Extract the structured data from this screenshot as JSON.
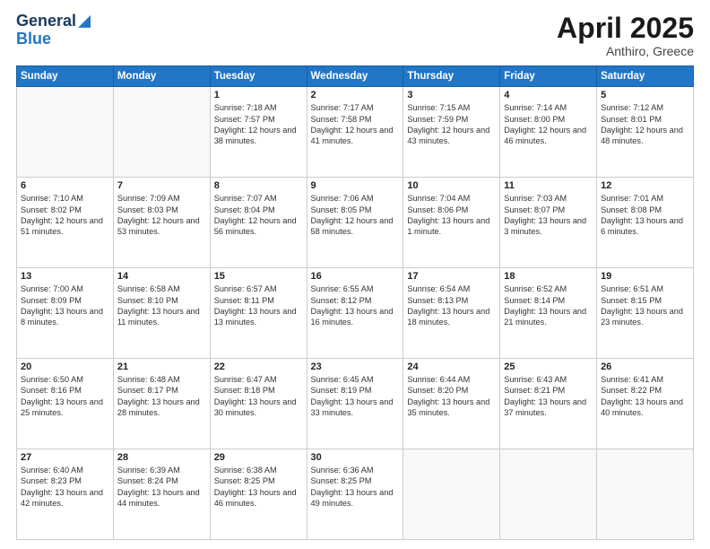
{
  "header": {
    "logo_general": "General",
    "logo_blue": "Blue",
    "title": "April 2025",
    "location": "Anthiro, Greece"
  },
  "days_of_week": [
    "Sunday",
    "Monday",
    "Tuesday",
    "Wednesday",
    "Thursday",
    "Friday",
    "Saturday"
  ],
  "weeks": [
    [
      {
        "day": "",
        "info": ""
      },
      {
        "day": "",
        "info": ""
      },
      {
        "day": "1",
        "info": "Sunrise: 7:18 AM\nSunset: 7:57 PM\nDaylight: 12 hours and 38 minutes."
      },
      {
        "day": "2",
        "info": "Sunrise: 7:17 AM\nSunset: 7:58 PM\nDaylight: 12 hours and 41 minutes."
      },
      {
        "day": "3",
        "info": "Sunrise: 7:15 AM\nSunset: 7:59 PM\nDaylight: 12 hours and 43 minutes."
      },
      {
        "day": "4",
        "info": "Sunrise: 7:14 AM\nSunset: 8:00 PM\nDaylight: 12 hours and 46 minutes."
      },
      {
        "day": "5",
        "info": "Sunrise: 7:12 AM\nSunset: 8:01 PM\nDaylight: 12 hours and 48 minutes."
      }
    ],
    [
      {
        "day": "6",
        "info": "Sunrise: 7:10 AM\nSunset: 8:02 PM\nDaylight: 12 hours and 51 minutes."
      },
      {
        "day": "7",
        "info": "Sunrise: 7:09 AM\nSunset: 8:03 PM\nDaylight: 12 hours and 53 minutes."
      },
      {
        "day": "8",
        "info": "Sunrise: 7:07 AM\nSunset: 8:04 PM\nDaylight: 12 hours and 56 minutes."
      },
      {
        "day": "9",
        "info": "Sunrise: 7:06 AM\nSunset: 8:05 PM\nDaylight: 12 hours and 58 minutes."
      },
      {
        "day": "10",
        "info": "Sunrise: 7:04 AM\nSunset: 8:06 PM\nDaylight: 13 hours and 1 minute."
      },
      {
        "day": "11",
        "info": "Sunrise: 7:03 AM\nSunset: 8:07 PM\nDaylight: 13 hours and 3 minutes."
      },
      {
        "day": "12",
        "info": "Sunrise: 7:01 AM\nSunset: 8:08 PM\nDaylight: 13 hours and 6 minutes."
      }
    ],
    [
      {
        "day": "13",
        "info": "Sunrise: 7:00 AM\nSunset: 8:09 PM\nDaylight: 13 hours and 8 minutes."
      },
      {
        "day": "14",
        "info": "Sunrise: 6:58 AM\nSunset: 8:10 PM\nDaylight: 13 hours and 11 minutes."
      },
      {
        "day": "15",
        "info": "Sunrise: 6:57 AM\nSunset: 8:11 PM\nDaylight: 13 hours and 13 minutes."
      },
      {
        "day": "16",
        "info": "Sunrise: 6:55 AM\nSunset: 8:12 PM\nDaylight: 13 hours and 16 minutes."
      },
      {
        "day": "17",
        "info": "Sunrise: 6:54 AM\nSunset: 8:13 PM\nDaylight: 13 hours and 18 minutes."
      },
      {
        "day": "18",
        "info": "Sunrise: 6:52 AM\nSunset: 8:14 PM\nDaylight: 13 hours and 21 minutes."
      },
      {
        "day": "19",
        "info": "Sunrise: 6:51 AM\nSunset: 8:15 PM\nDaylight: 13 hours and 23 minutes."
      }
    ],
    [
      {
        "day": "20",
        "info": "Sunrise: 6:50 AM\nSunset: 8:16 PM\nDaylight: 13 hours and 25 minutes."
      },
      {
        "day": "21",
        "info": "Sunrise: 6:48 AM\nSunset: 8:17 PM\nDaylight: 13 hours and 28 minutes."
      },
      {
        "day": "22",
        "info": "Sunrise: 6:47 AM\nSunset: 8:18 PM\nDaylight: 13 hours and 30 minutes."
      },
      {
        "day": "23",
        "info": "Sunrise: 6:45 AM\nSunset: 8:19 PM\nDaylight: 13 hours and 33 minutes."
      },
      {
        "day": "24",
        "info": "Sunrise: 6:44 AM\nSunset: 8:20 PM\nDaylight: 13 hours and 35 minutes."
      },
      {
        "day": "25",
        "info": "Sunrise: 6:43 AM\nSunset: 8:21 PM\nDaylight: 13 hours and 37 minutes."
      },
      {
        "day": "26",
        "info": "Sunrise: 6:41 AM\nSunset: 8:22 PM\nDaylight: 13 hours and 40 minutes."
      }
    ],
    [
      {
        "day": "27",
        "info": "Sunrise: 6:40 AM\nSunset: 8:23 PM\nDaylight: 13 hours and 42 minutes."
      },
      {
        "day": "28",
        "info": "Sunrise: 6:39 AM\nSunset: 8:24 PM\nDaylight: 13 hours and 44 minutes."
      },
      {
        "day": "29",
        "info": "Sunrise: 6:38 AM\nSunset: 8:25 PM\nDaylight: 13 hours and 46 minutes."
      },
      {
        "day": "30",
        "info": "Sunrise: 6:36 AM\nSunset: 8:25 PM\nDaylight: 13 hours and 49 minutes."
      },
      {
        "day": "",
        "info": ""
      },
      {
        "day": "",
        "info": ""
      },
      {
        "day": "",
        "info": ""
      }
    ]
  ]
}
